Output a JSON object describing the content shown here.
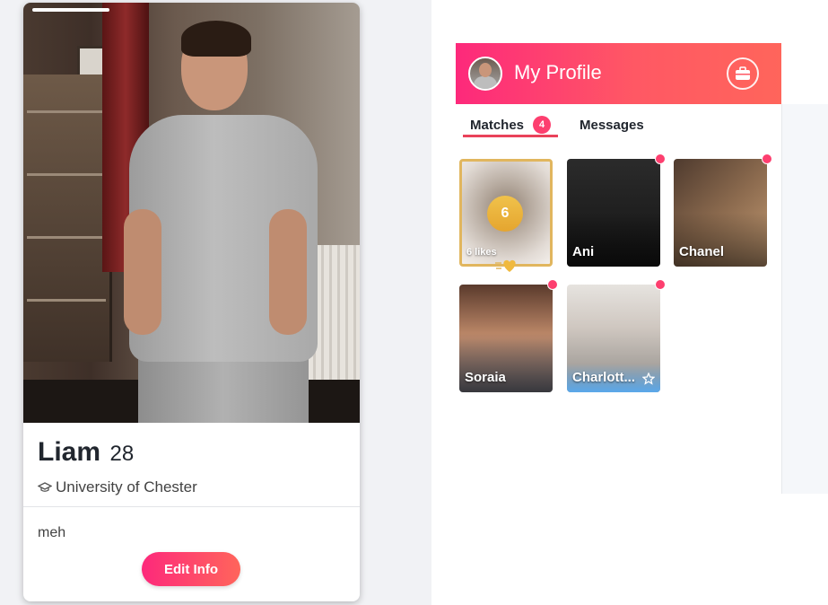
{
  "profile": {
    "name": "Liam",
    "age": "28",
    "school": "University of Chester",
    "bio": "meh",
    "edit_label": "Edit Info"
  },
  "panel": {
    "title": "My Profile",
    "tabs": {
      "matches": "Matches",
      "matches_count": "4",
      "messages": "Messages"
    },
    "likes": {
      "count": "6",
      "label": "6 likes"
    },
    "matches": [
      {
        "name": "Ani"
      },
      {
        "name": "Chanel"
      },
      {
        "name": "Soraia"
      },
      {
        "name": "Charlott..."
      }
    ]
  },
  "colors": {
    "brand_start": "#fd297b",
    "brand_end": "#ff655b",
    "unread_dot": "#fd3f6f",
    "likes_gold": "#e1b65e"
  },
  "icons": {
    "school": "graduation-cap-icon",
    "header_action": "briefcase-icon",
    "likes": "heart-icon",
    "verified": "star-icon"
  }
}
